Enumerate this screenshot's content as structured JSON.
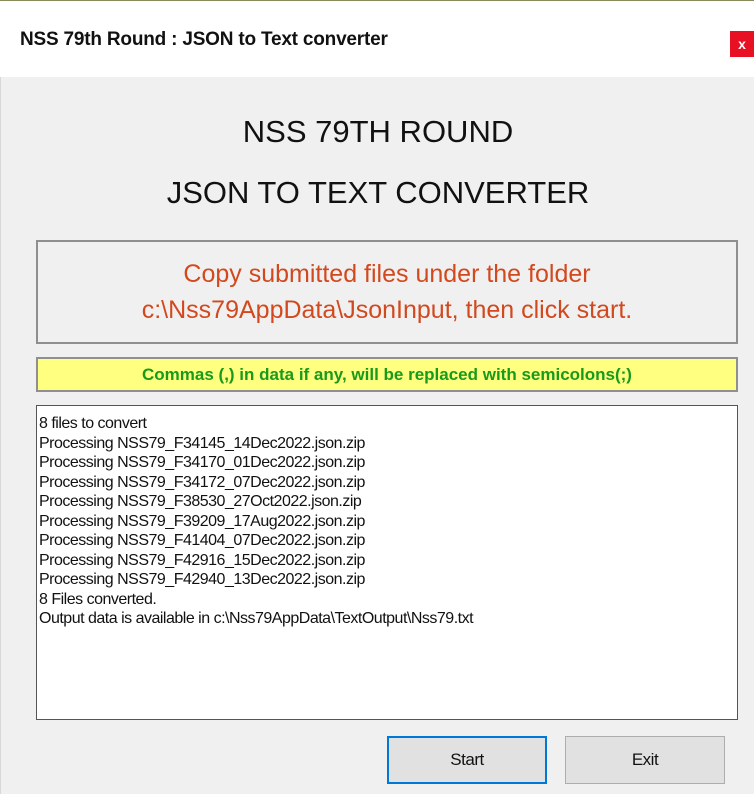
{
  "window": {
    "title": "NSS 79th Round : JSON to Text converter",
    "close_label": "x"
  },
  "headings": {
    "line1": "NSS 79TH ROUND",
    "line2": "JSON TO TEXT CONVERTER"
  },
  "instruction": {
    "line1": "Copy submitted files under the folder",
    "line2": "c:\\Nss79AppData\\JsonInput, then click start."
  },
  "note": "Commas (,) in data if any, will be replaced with semicolons(;)",
  "log": [
    "8 files to convert",
    "Processing NSS79_F34145_14Dec2022.json.zip",
    "Processing NSS79_F34170_01Dec2022.json.zip",
    "Processing NSS79_F34172_07Dec2022.json.zip",
    "Processing NSS79_F38530_27Oct2022.json.zip",
    "Processing NSS79_F39209_17Aug2022.json.zip",
    "Processing NSS79_F41404_07Dec2022.json.zip",
    "Processing NSS79_F42916_15Dec2022.json.zip",
    "Processing NSS79_F42940_13Dec2022.json.zip",
    "8 Files converted.",
    "Output data is available in c:\\Nss79AppData\\TextOutput\\Nss79.txt"
  ],
  "buttons": {
    "start": "Start",
    "exit": "Exit"
  },
  "colors": {
    "instruction_text": "#d2491e",
    "note_text": "#1a9a1a",
    "note_background": "#ffff80",
    "close_button": "#e81123",
    "focus_border": "#0078d7"
  }
}
